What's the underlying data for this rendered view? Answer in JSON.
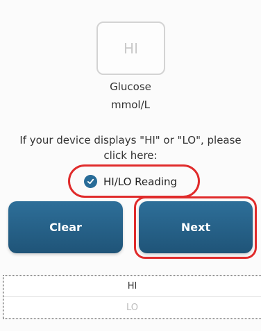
{
  "reading": {
    "value": "HI"
  },
  "measurement": {
    "name": "Glucose",
    "unit": "mmol/L"
  },
  "instructions": "If your device displays \"HI\" or \"LO\", please click here:",
  "hilo_toggle": {
    "label": "HI/LO Reading",
    "checked": true
  },
  "buttons": {
    "clear": "Clear",
    "next": "Next"
  },
  "hilo_options": [
    "HI",
    "LO"
  ],
  "colors": {
    "accent": "#286c98",
    "highlight": "#e02b2b"
  }
}
